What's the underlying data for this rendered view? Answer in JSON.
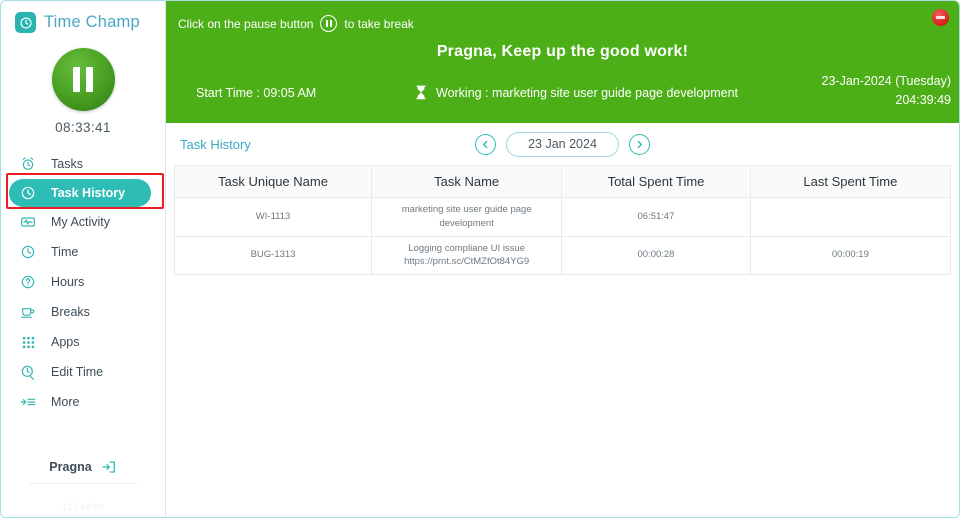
{
  "app": {
    "brand_name": "Time Champ",
    "logo_icon": "clock-icon",
    "accent_teal": "#2dbdb6",
    "banner_green": "#4caf17",
    "annotation_red": "#ee1c25"
  },
  "sidebar": {
    "pause_icon": "pause-icon",
    "session_timer": "08:33:41",
    "items": [
      {
        "label": "Tasks",
        "icon": "alarm-clock-icon",
        "active": false
      },
      {
        "label": "Task History",
        "icon": "history-clock-icon",
        "active": true
      },
      {
        "label": "My Activity",
        "icon": "activity-icon",
        "active": false
      },
      {
        "label": "Time",
        "icon": "clock-icon",
        "active": false
      },
      {
        "label": "Hours",
        "icon": "question-circle-icon",
        "active": false
      },
      {
        "label": "Breaks",
        "icon": "coffee-cup-icon",
        "active": false
      },
      {
        "label": "Apps",
        "icon": "grid-dots-icon",
        "active": false
      },
      {
        "label": "Edit Time",
        "icon": "edit-clock-icon",
        "active": false
      },
      {
        "label": "More",
        "icon": "more-list-icon",
        "active": false
      }
    ],
    "user_name": "Pragna",
    "logout_icon": "logout-icon",
    "build_id": "1234890"
  },
  "banner": {
    "hint_prefix": "Click on the pause button",
    "hint_icon": "pause-circle-icon",
    "hint_suffix": "to take break",
    "close_icon": "minimize-icon",
    "greeting": "Pragna, Keep up the good work!",
    "date": "23-Jan-2024 (Tuesday)",
    "total_timer": "204:39:49",
    "start_time": "Start Time : 09:05 AM",
    "working_icon": "hourglass-icon",
    "working_text": "Working : marketing site user guide page development"
  },
  "toolbar": {
    "title": "Task History",
    "prev_icon": "chevron-left-icon",
    "next_icon": "chevron-right-icon",
    "selected_date": "23 Jan 2024"
  },
  "table": {
    "columns": [
      "Task Unique Name",
      "Task Name",
      "Total Spent Time",
      "Last Spent Time"
    ],
    "rows": [
      {
        "unique_name": "WI-1113",
        "task_name": "marketing site user guide page development",
        "total_spent": "06:51:47",
        "last_spent": ""
      },
      {
        "unique_name": "BUG-1313",
        "task_name": "Logging compliane UI issue https://prnt.sc/CtMZfOt84YG9",
        "total_spent": "00:00:28",
        "last_spent": "00:00:19"
      }
    ]
  }
}
